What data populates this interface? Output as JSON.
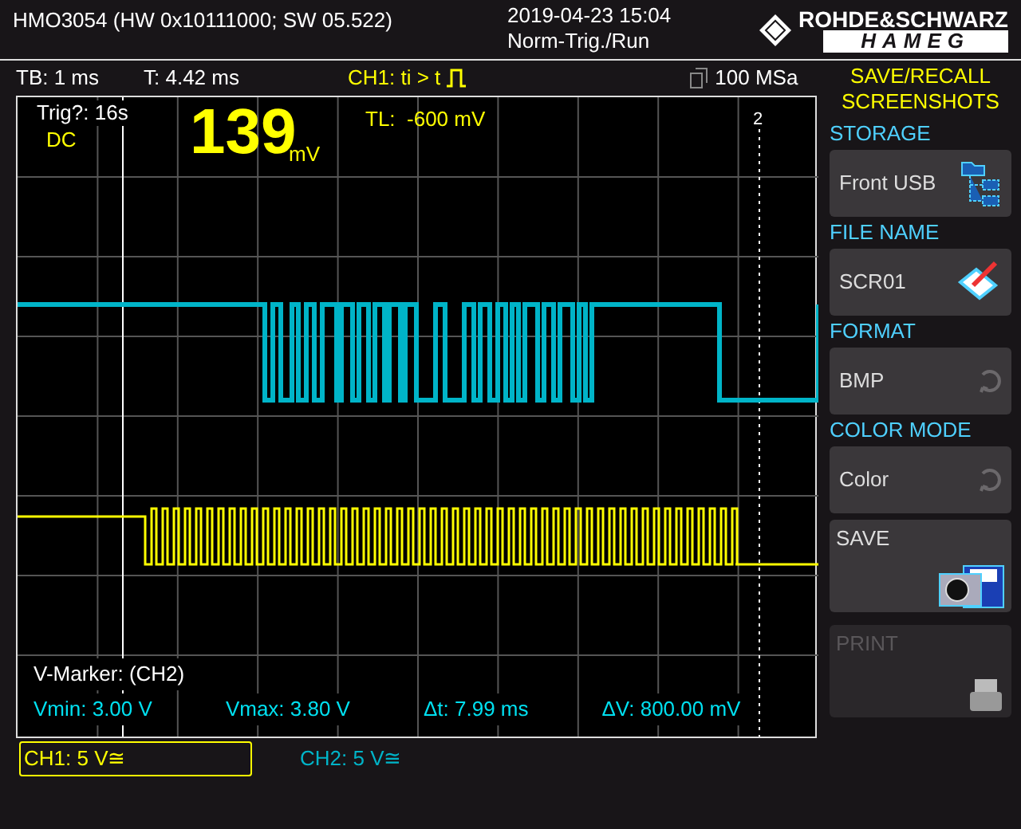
{
  "header": {
    "model": "HMO3054 (HW 0x10111000; SW 05.522)",
    "datetime": "2019-04-23 15:04",
    "trigger_status": "Norm-Trig./Run",
    "logo_top": "ROHDE&SCHWARZ",
    "logo_bottom": "HAMEG"
  },
  "status_bar": {
    "timebase": "TB: 1 ms",
    "trigger_time": "T: 4.42 ms",
    "trigger": "CH1: ti > t",
    "sample_rate": "100 MSa"
  },
  "screen": {
    "trig_label": "Trig?: 16s",
    "coupling": "DC",
    "amplitude": "139",
    "amplitude_unit": "mV",
    "trigger_level": "TL:  -600 mV",
    "marker_number": "2",
    "marker_title": "V-Marker: (CH2)",
    "readouts": [
      "Vmin: 3.00 V",
      "Vmax: 3.80 V",
      "Δt: 7.99 ms",
      "ΔV: 800.00 mV"
    ]
  },
  "channels": [
    {
      "label": "CH1: 5 V≅",
      "selected": true,
      "color": "#ffff00"
    },
    {
      "label": "CH2: 5 V≅",
      "selected": false,
      "color": "#00b4c8"
    }
  ],
  "menu": {
    "title": [
      "SAVE/RECALL",
      "SCREENSHOTS"
    ],
    "items": [
      {
        "heading": "STORAGE",
        "value": "Front USB",
        "kind": "folder",
        "disabled": false
      },
      {
        "heading": "FILE NAME",
        "value": "SCR01",
        "kind": "notepad",
        "disabled": false
      },
      {
        "heading": "FORMAT",
        "value": "BMP",
        "kind": "cycle",
        "disabled": false
      },
      {
        "heading": "COLOR MODE",
        "value": "Color",
        "kind": "cycle",
        "disabled": false
      },
      {
        "value": "SAVE",
        "kind": "camera",
        "disabled": false
      },
      {
        "value": "PRINT",
        "kind": "printer",
        "disabled": true
      }
    ]
  }
}
